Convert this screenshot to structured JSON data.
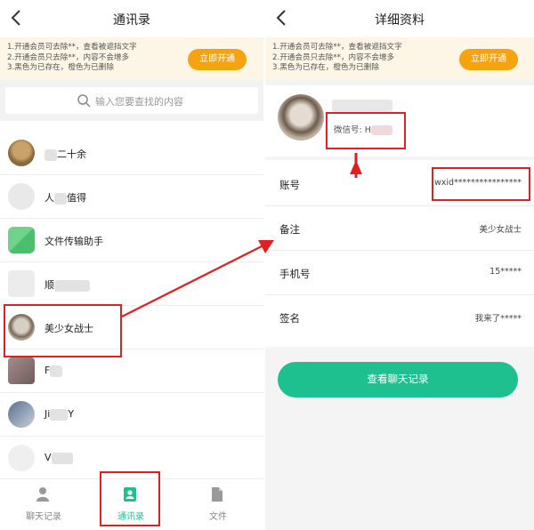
{
  "left": {
    "title": "通讯录",
    "promo": {
      "lines": [
        "1.开通会员可去除**，查看被遮挡文字",
        "2.开通会员只去除**，内容不会增多",
        "3.黑色为已存在，橙色为已删除"
      ],
      "button_label": "立即开通"
    },
    "search": {
      "placeholder": "输入您要查找的内容"
    },
    "contacts": [
      {
        "prefix": "",
        "suffix": "二十余"
      },
      {
        "prefix": "人",
        "suffix": "值得"
      },
      {
        "prefix": "文件传输助手",
        "suffix": ""
      },
      {
        "prefix": "顺",
        "suffix": ""
      },
      {
        "prefix": "美少女战士",
        "suffix": ""
      },
      {
        "prefix": "F",
        "suffix": ""
      },
      {
        "prefix": "Ji",
        "suffix": "Y"
      },
      {
        "prefix": "V",
        "suffix": ""
      }
    ],
    "tabs": [
      {
        "label": "聊天记录",
        "icon": "person-icon"
      },
      {
        "label": "通讯录",
        "icon": "contacts-icon"
      },
      {
        "label": "文件",
        "icon": "file-icon"
      }
    ]
  },
  "right": {
    "title": "详细资料",
    "promo": {
      "lines": [
        "1.开通会员可去除**，查看被遮挡文字",
        "2.开通会员只去除**，内容不会增多",
        "3.黑色为已存在，橙色为已删除"
      ],
      "button_label": "立即开通"
    },
    "profile": {
      "wechat_id": "微信号: H"
    },
    "rows": [
      {
        "label": "账号",
        "value": "wxid****************"
      },
      {
        "label": "备注",
        "value": "美少女战士"
      },
      {
        "label": "手机号",
        "value": "15*****"
      },
      {
        "label": "签名",
        "value": "我来了*****"
      }
    ],
    "chat_button": "查看聊天记录"
  },
  "colors": {
    "accent_green": "#1fc08f",
    "accent_orange": "#f5a30f",
    "highlight_red": "#e02020",
    "promo_bg": "#fdf6e6"
  }
}
